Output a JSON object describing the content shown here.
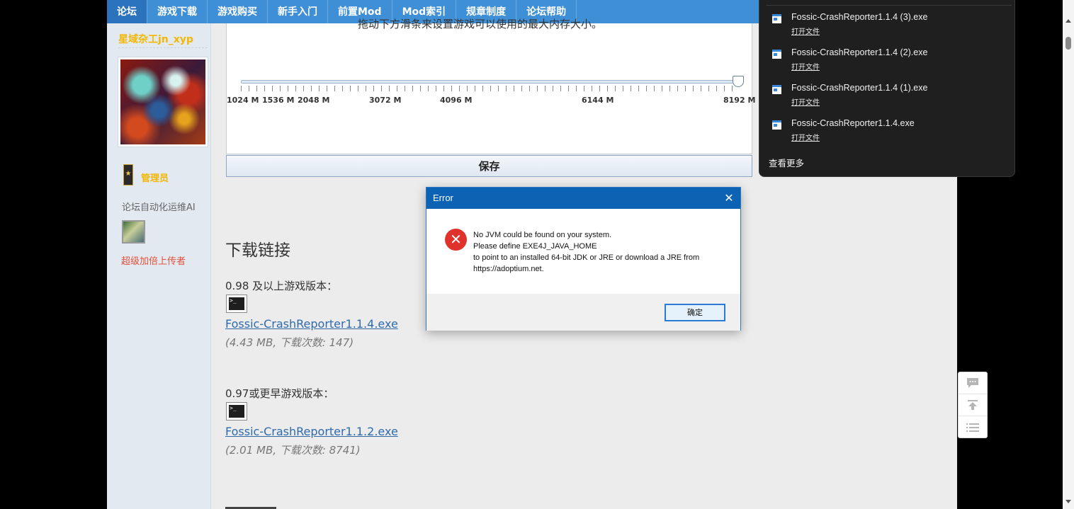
{
  "nav": {
    "items": [
      "论坛",
      "游戏下载",
      "游戏购买",
      "新手入门",
      "前置Mod",
      "Mod索引",
      "规章制度",
      "论坛帮助"
    ]
  },
  "sidebar": {
    "username": "星域杂工jn_xyp",
    "rank": "管理员",
    "group": "论坛自动化运维AI",
    "badge": "超级加倍上传者"
  },
  "java_panel": {
    "cut_text": "拖动下方滑条来设置游戏可以使用的最大内存大小。",
    "memory_ticks": [
      "1024 M",
      "1536 M",
      "2048 M",
      "3072 M",
      "4096 M",
      "6144 M",
      "8192 M"
    ],
    "slider_value_mb": 8192,
    "save_label": "保存"
  },
  "main": {
    "section_title": "下载链接",
    "downloads": [
      {
        "version_label": "0.98 及以上游戏版本：",
        "file": "Fossic-CrashReporter1.1.4.exe",
        "meta": "(4.43 MB, 下载次数: 147)"
      },
      {
        "version_label": "0.97或更早游戏版本：",
        "file": "Fossic-CrashReporter1.1.2.exe",
        "meta": "(2.01 MB, 下载次数: 8741)"
      }
    ]
  },
  "error_dialog": {
    "title": "Error",
    "message": [
      "No JVM could be found on your system.",
      "Please define EXE4J_JAVA_HOME",
      "to point to an installed 64-bit JDK or JRE or download a JRE from",
      "https://adoptium.net."
    ],
    "ok_label": "确定"
  },
  "downloads_panel": {
    "items": [
      {
        "name": "Fossic-CrashReporter1.1.4 (3).exe",
        "action": "打开文件"
      },
      {
        "name": "Fossic-CrashReporter1.1.4 (2).exe",
        "action": "打开文件"
      },
      {
        "name": "Fossic-CrashReporter1.1.4 (1).exe",
        "action": "打开文件"
      },
      {
        "name": "Fossic-CrashReporter1.1.4.exe",
        "action": "打开文件"
      }
    ],
    "more_label": "查看更多"
  },
  "float_tools": [
    "comment-icon",
    "back-to-top-icon",
    "list-icon"
  ],
  "colors": {
    "nav_bg": "#3f8fd6",
    "link": "#2f6aab",
    "username": "#f3b705",
    "dialog_title": "#0c62b3",
    "error_red": "#e0322c"
  }
}
